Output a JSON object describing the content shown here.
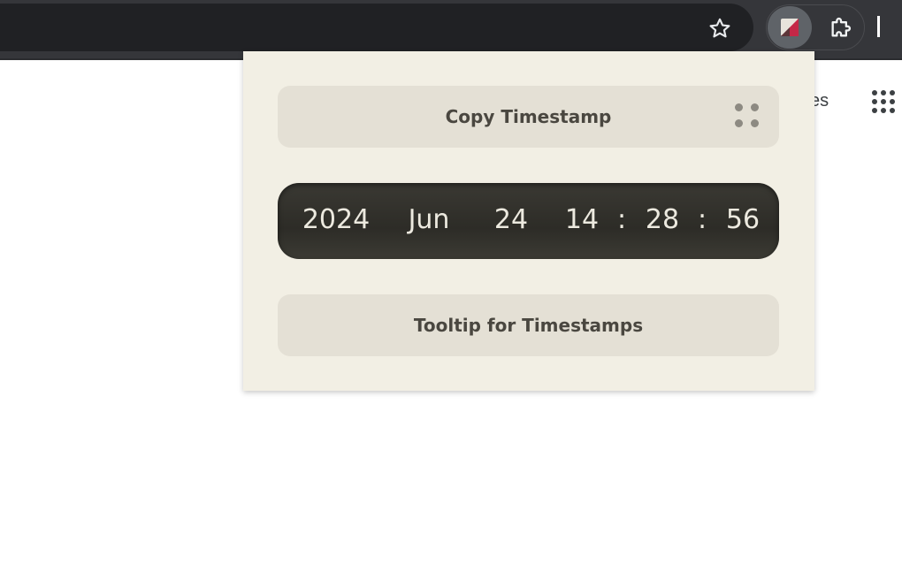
{
  "browser": {
    "bookmark_icon": "star-outline-icon",
    "extension_icon": "timestamp-extension-icon",
    "extensions_menu_icon": "puzzle-piece-icon",
    "apps_icon": "apps-grid-icon",
    "page_partial_text": "es"
  },
  "popup": {
    "copy_button_label": "Copy Timestamp",
    "drag_handle_icon": "drag-dots-icon",
    "timestamp": {
      "year": "2024",
      "month": "Jun",
      "day": "24",
      "hour": "14",
      "minute": "28",
      "second": "56",
      "separator": ":"
    },
    "tooltip_button_label": "Tooltip for Timestamps"
  },
  "colors": {
    "toolbar": "#35363a",
    "omnibox": "#202124",
    "popup_bg": "#f2efe4",
    "button_bg": "#e4e0d5",
    "display_bg": "#2d2c27",
    "display_text": "#ece9df"
  }
}
